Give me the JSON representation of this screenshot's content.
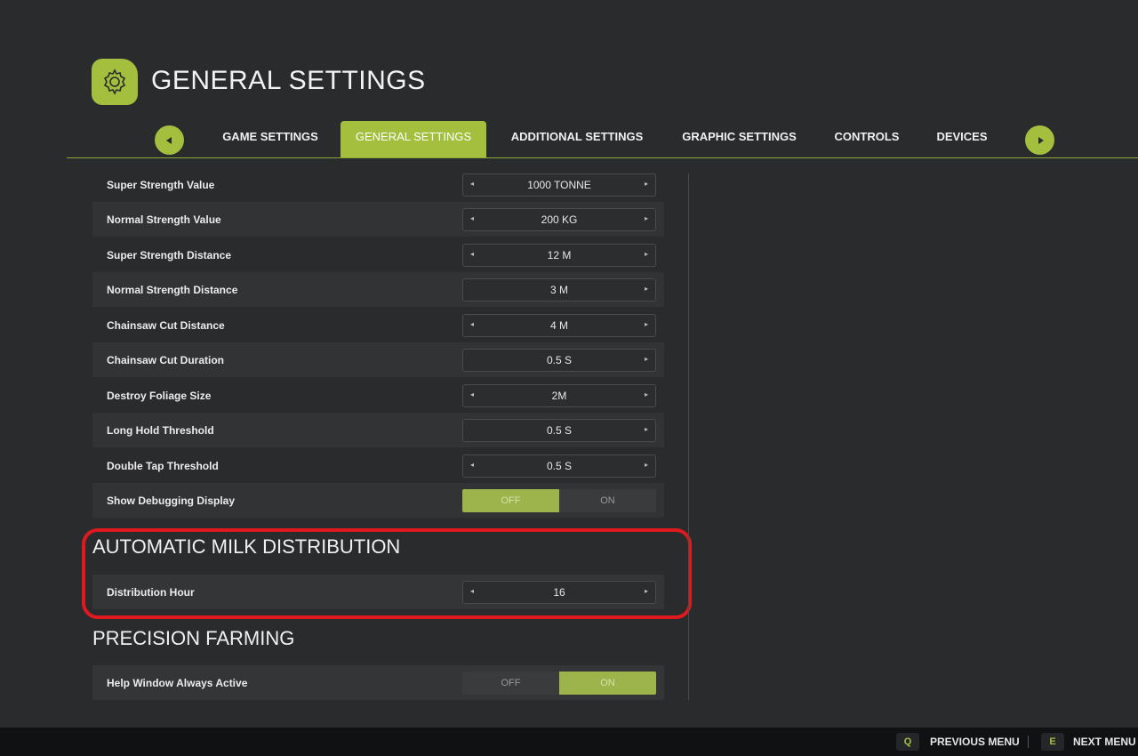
{
  "header": {
    "title": "GENERAL SETTINGS",
    "icon": "gear-icon"
  },
  "tabs": [
    {
      "label": "GAME SETTINGS",
      "active": false
    },
    {
      "label": "GENERAL SETTINGS",
      "active": true
    },
    {
      "label": "ADDITIONAL SETTINGS",
      "active": false
    },
    {
      "label": "GRAPHIC SETTINGS",
      "active": false
    },
    {
      "label": "CONTROLS",
      "active": false
    },
    {
      "label": "DEVICES",
      "active": false
    }
  ],
  "settings": [
    {
      "label": "Super Strength Value",
      "value": "1000 TONNE"
    },
    {
      "label": "Normal Strength Value",
      "value": "200 KG"
    },
    {
      "label": "Super Strength Distance",
      "value": "12 M"
    },
    {
      "label": "Normal Strength Distance",
      "value": "3 M"
    },
    {
      "label": "Chainsaw Cut Distance",
      "value": "4 M"
    },
    {
      "label": "Chainsaw Cut Duration",
      "value": "0.5 S"
    },
    {
      "label": "Destroy Foliage Size",
      "value": "2M"
    },
    {
      "label": "Long Hold Threshold",
      "value": "0.5 S"
    },
    {
      "label": "Double Tap Threshold",
      "value": "0.5 S"
    },
    {
      "label": "Show Debugging Display",
      "off": "OFF",
      "on": "ON",
      "selected": "off"
    }
  ],
  "milk": {
    "title": "AUTOMATIC MILK DISTRIBUTION",
    "row": {
      "label": "Distribution Hour",
      "value": "16"
    }
  },
  "precision": {
    "title": "PRECISION FARMING",
    "row": {
      "label": "Help Window Always Active",
      "off": "OFF",
      "on": "ON",
      "selected": "on"
    }
  },
  "footer": {
    "prev_key": "Q",
    "prev_label": "PREVIOUS MENU",
    "next_key": "E",
    "next_label": "NEXT MENU"
  },
  "colors": {
    "accent": "#a3bf3d",
    "highlight": "#e0191e",
    "background": "#2a2b2d"
  }
}
